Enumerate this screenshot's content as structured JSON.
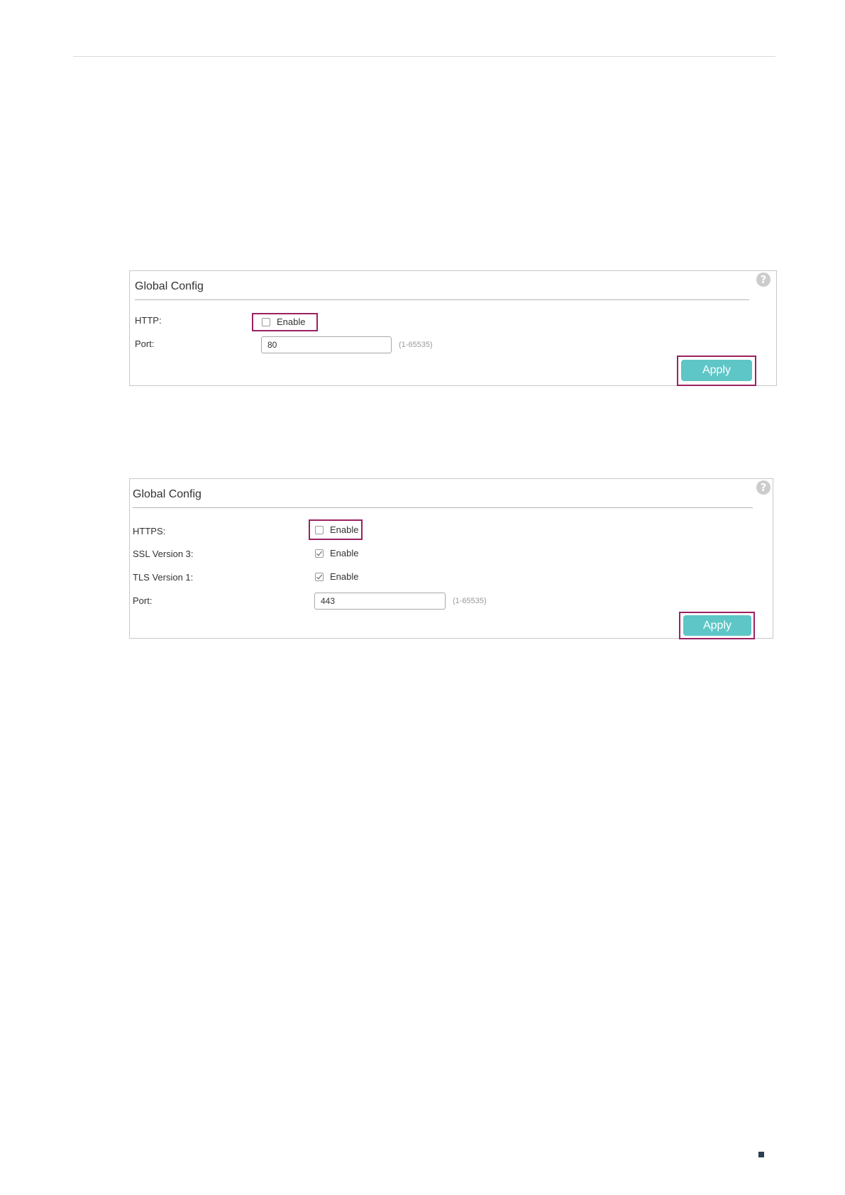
{
  "http_panel": {
    "title": "Global Config",
    "help_icon_glyph": "?",
    "http_label": "HTTP:",
    "http_enable_label": "Enable",
    "http_enabled": false,
    "port_label": "Port:",
    "port_value": "80",
    "port_range": "(1-65535)",
    "apply_label": "Apply"
  },
  "https_panel": {
    "title": "Global Config",
    "help_icon_glyph": "?",
    "https_label": "HTTPS:",
    "https_enable_label": "Enable",
    "https_enabled": false,
    "ssl_label": "SSL Version 3:",
    "ssl_enable_label": "Enable",
    "ssl_enabled": true,
    "tls_label": "TLS Version 1:",
    "tls_enable_label": "Enable",
    "tls_enabled": true,
    "port_label": "Port:",
    "port_value": "443",
    "port_range": "(1-65535)",
    "apply_label": "Apply"
  },
  "colors": {
    "highlight": "#9b2161",
    "apply_button": "#5ec6c6",
    "page_marker": "#2b3f52"
  }
}
